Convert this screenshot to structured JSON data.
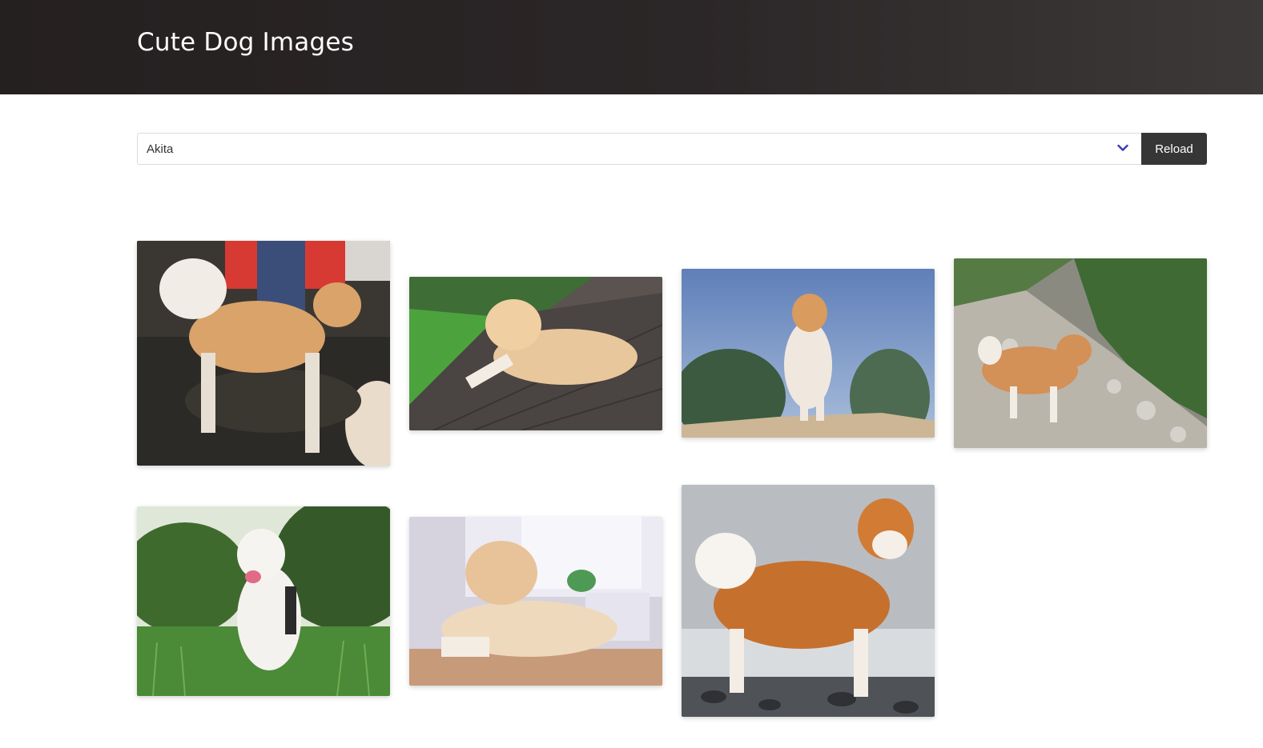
{
  "header": {
    "title": "Cute Dog Images"
  },
  "controls": {
    "selected_breed": "Akita",
    "reload_label": "Reload",
    "chevron_icon": "chevron-down-icon",
    "accent": "#3b3bb8"
  },
  "gallery": {
    "images": [
      {
        "name": "dog-photo-1",
        "scene": "indoor-dark-floor"
      },
      {
        "name": "dog-photo-2",
        "scene": "wooden-deck"
      },
      {
        "name": "dog-photo-3",
        "scene": "sky-sand"
      },
      {
        "name": "dog-photo-4",
        "scene": "rocky-hillside"
      },
      {
        "name": "dog-photo-5",
        "scene": "grass-trees"
      },
      {
        "name": "dog-photo-6",
        "scene": "indoor-floor"
      },
      {
        "name": "dog-photo-7",
        "scene": "beach-pebbles"
      }
    ]
  }
}
